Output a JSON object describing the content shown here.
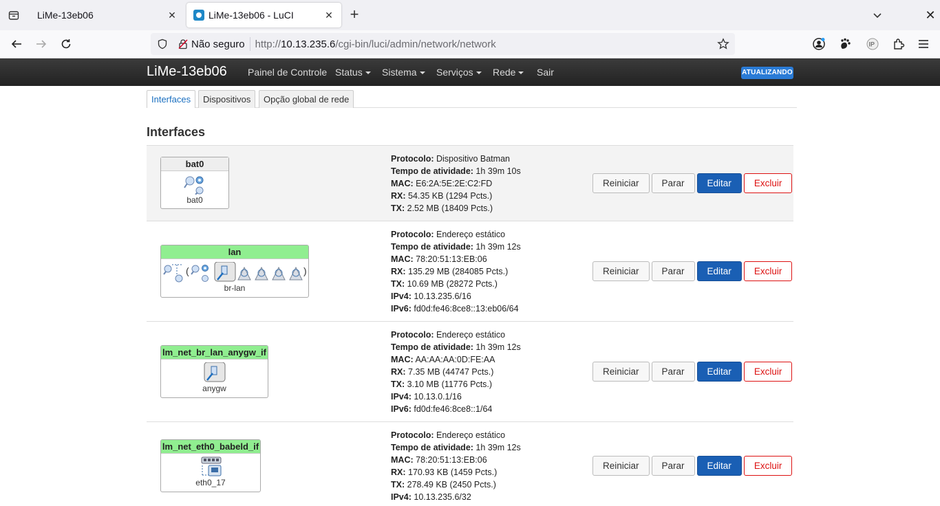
{
  "browser": {
    "tabs": [
      {
        "title": "LiMe-13eb06",
        "active": false
      },
      {
        "title": "LiMe-13eb06 - LuCI",
        "active": true
      }
    ],
    "url_security": "Não seguro",
    "url_prefix": "http://",
    "url_host": "10.13.235.6",
    "url_path": "/cgi-bin/luci/admin/network/network"
  },
  "header": {
    "brand": "LiMe-13eb06",
    "menu": [
      "Painel de Controle",
      "Status",
      "Sistema",
      "Serviços",
      "Rede",
      "Sair"
    ],
    "badge": "ATUALIZANDO"
  },
  "subtabs": [
    "Interfaces",
    "Dispositivos",
    "Opção global de rede"
  ],
  "section_title": "Interfaces",
  "labels": {
    "protocol": "Protocolo:",
    "uptime": "Tempo de atividade:",
    "mac": "MAC:",
    "rx": "RX:",
    "tx": "TX:",
    "ipv4": "IPv4:",
    "ipv6": "IPv6:"
  },
  "buttons": {
    "restart": "Reiniciar",
    "stop": "Parar",
    "edit": "Editar",
    "delete": "Excluir"
  },
  "interfaces": [
    {
      "name": "bat0",
      "device": "bat0",
      "protocol": "Dispositivo Batman",
      "uptime": "1h 39m 10s",
      "mac": "E6:2A:5E:2E:C2:FD",
      "rx": "54.35 KB (1294 Pcts.)",
      "tx": "2.52 MB (18409 Pcts.)"
    },
    {
      "name": "lan",
      "device": "br-lan",
      "protocol": "Endereço estático",
      "uptime": "1h 39m 12s",
      "mac": "78:20:51:13:EB:06",
      "rx": "135.29 MB (284085 Pcts.)",
      "tx": "10.69 MB (28272 Pcts.)",
      "ipv4": "10.13.235.6/16",
      "ipv6": "fd0d:fe46:8ce8::13:eb06/64"
    },
    {
      "name": "lm_net_br_lan_anygw_if",
      "device": "anygw",
      "protocol": "Endereço estático",
      "uptime": "1h 39m 12s",
      "mac": "AA:AA:AA:0D:FE:AA",
      "rx": "7.35 MB (44747 Pcts.)",
      "tx": "3.10 MB (11776 Pcts.)",
      "ipv4": "10.13.0.1/16",
      "ipv6": "fd0d:fe46:8ce8::1/64"
    },
    {
      "name": "lm_net_eth0_babeld_if",
      "device": "eth0_17",
      "protocol": "Endereço estático",
      "uptime": "1h 39m 12s",
      "mac": "78:20:51:13:EB:06",
      "rx": "170.93 KB (1459 Pcts.)",
      "tx": "278.49 KB (2450 Pcts.)",
      "ipv4": "10.13.235.6/32"
    }
  ]
}
